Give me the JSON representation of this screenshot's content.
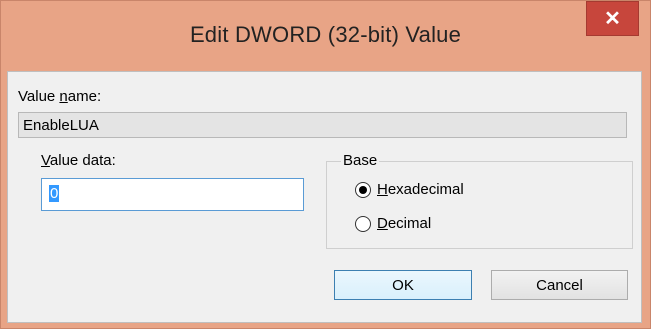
{
  "window": {
    "title": "Edit DWORD (32-bit) Value",
    "close_glyph": "✕"
  },
  "value_name": {
    "label_pre": "Value ",
    "label_mnemonic": "n",
    "label_post": "ame:",
    "value": "EnableLUA"
  },
  "value_data": {
    "label_mnemonic": "V",
    "label_post": "alue data:",
    "value": "0"
  },
  "base": {
    "label": "Base",
    "options": [
      {
        "mnemonic": "H",
        "rest": "exadecimal",
        "selected": true
      },
      {
        "mnemonic": "D",
        "rest": "ecimal",
        "selected": false
      }
    ]
  },
  "buttons": {
    "ok": "OK",
    "cancel": "Cancel"
  },
  "colors": {
    "frame": "#e8a486",
    "close": "#c7463c",
    "client": "#f0f0f0",
    "selection": "#3399ff"
  }
}
